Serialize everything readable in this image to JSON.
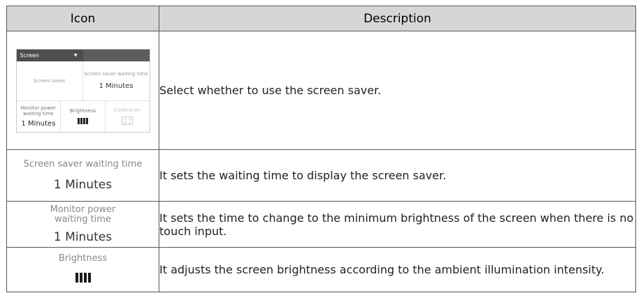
{
  "table": {
    "headers": {
      "icon": "Icon",
      "description": "Description"
    },
    "rows": [
      {
        "widget": {
          "tab_label": "Screen",
          "screen_saver": "Screen saver",
          "waiting_label": "Screen saver waiting time",
          "waiting_value": "1 Minutes",
          "power_label_1": "Monitor power",
          "power_label_2": "waiting time",
          "power_value": "1 Minutes",
          "brightness_label": "Brightness",
          "calibration_label": "Calibration"
        },
        "description": "Select whether to use the screen saver."
      },
      {
        "icon_label": "Screen saver waiting time",
        "icon_value": "1 Minutes",
        "description": "It sets the waiting time to display the screen saver."
      },
      {
        "icon_label_1": "Monitor power",
        "icon_label_2": "waiting time",
        "icon_value": "1 Minutes",
        "description": "It sets the time to change to the minimum brightness of the screen when there is no touch input."
      },
      {
        "icon_label": "Brightness",
        "description": "It adjusts the screen brightness according to the ambient illumination intensity."
      }
    ]
  }
}
